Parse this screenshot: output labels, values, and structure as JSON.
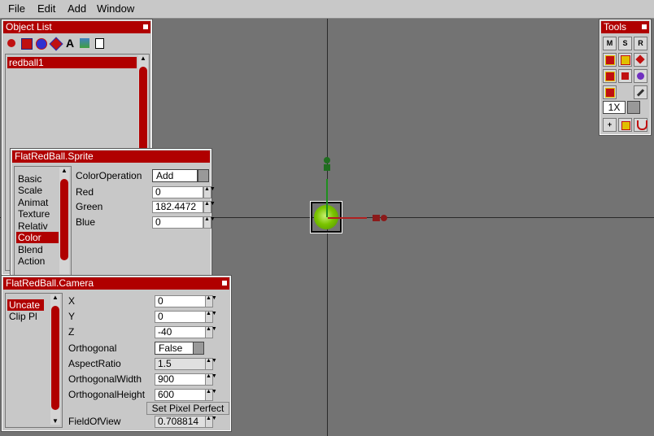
{
  "menu": {
    "file": "File",
    "edit": "Edit",
    "add": "Add",
    "window": "Window"
  },
  "object_list": {
    "title": "Object List",
    "items": [
      "redball1"
    ]
  },
  "sprite_window": {
    "title": "FlatRedBall.Sprite",
    "categories": [
      "Basic",
      "Scale",
      "Animat",
      "Texture",
      "Relativ",
      "Color",
      "Blend",
      "Action"
    ],
    "selected_category": "Color",
    "labels": {
      "color_operation": "ColorOperation",
      "red": "Red",
      "green": "Green",
      "blue": "Blue"
    },
    "values": {
      "color_operation": "Add",
      "red": "0",
      "green": "182.4472",
      "blue": "0"
    }
  },
  "camera_window": {
    "title": "FlatRedBall.Camera",
    "categories": [
      "Uncate",
      "Clip Pl"
    ],
    "selected_category": "Uncate",
    "labels": {
      "x": "X",
      "y": "Y",
      "z": "Z",
      "orthogonal": "Orthogonal",
      "aspect_ratio": "AspectRatio",
      "orthogonal_width": "OrthogonalWidth",
      "orthogonal_height": "OrthogonalHeight",
      "field_of_view": "FieldOfView"
    },
    "values": {
      "x": "0",
      "y": "0",
      "z": "-40",
      "orthogonal": "False",
      "aspect_ratio": "1.5",
      "orthogonal_width": "900",
      "orthogonal_height": "600",
      "field_of_view": "0.708814"
    },
    "set_pixel_perfect": "Set Pixel Perfect"
  },
  "tools_window": {
    "title": "Tools",
    "row1": [
      "M",
      "S",
      "R"
    ],
    "zoom": "1X"
  },
  "colors": {
    "accent": "#b00000",
    "viewport": "#737373",
    "ball": "#7ac400",
    "y_axis_handle": "#1f6e1f",
    "x_axis_handle": "#8c1a1a"
  }
}
